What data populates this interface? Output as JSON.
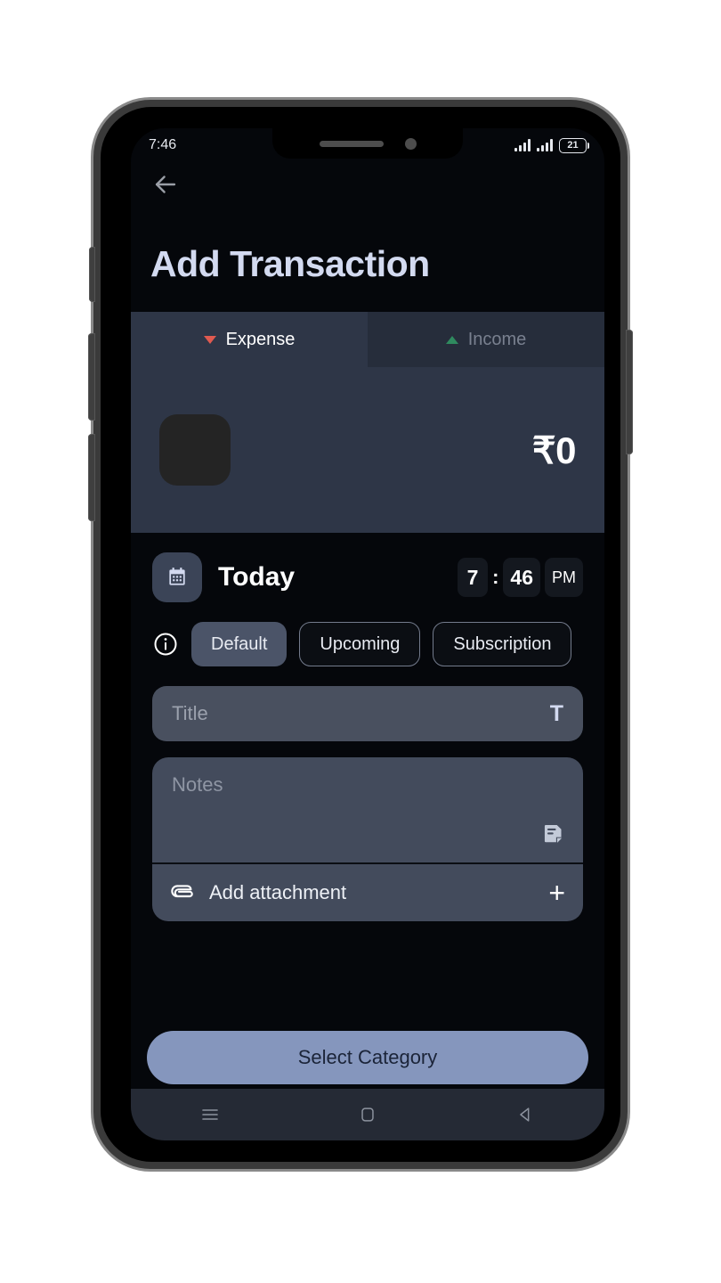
{
  "status_bar": {
    "time": "7:46",
    "battery_percent": "21",
    "signal_icon": "signal-bars-icon",
    "battery_icon": "battery-icon"
  },
  "header": {
    "back_icon": "back-arrow-icon",
    "title": "Add Transaction"
  },
  "tabs": [
    {
      "label": "Expense",
      "icon": "triangle-down-icon",
      "active": true,
      "accent": "#e05a50"
    },
    {
      "label": "Income",
      "icon": "triangle-up-icon",
      "active": false,
      "accent": "#2f8a5f"
    }
  ],
  "amount": {
    "thumbnail_name": "amount-thumbnail",
    "value": "₹0"
  },
  "date_row": {
    "calendar_icon": "calendar-icon",
    "date_label": "Today",
    "hour": "7",
    "separator": ":",
    "minute": "46",
    "meridiem": "PM"
  },
  "type_chips": {
    "info_icon": "info-icon",
    "items": [
      {
        "label": "Default",
        "selected": true
      },
      {
        "label": "Upcoming",
        "selected": false
      },
      {
        "label": "Subscription",
        "selected": false
      }
    ]
  },
  "title_field": {
    "placeholder": "Title",
    "value": "",
    "icon": "text-format-icon",
    "icon_glyph": "T"
  },
  "notes_field": {
    "placeholder": "Notes",
    "value": "",
    "icon": "note-icon"
  },
  "attachment": {
    "label": "Add attachment",
    "clip_icon": "paperclip-icon",
    "add_icon": "plus-icon",
    "add_glyph": "+"
  },
  "cta": {
    "label": "Select Category",
    "background": "#8596bd",
    "text_color": "#1b2438"
  },
  "navbar": {
    "menu_icon": "menu-icon",
    "home_icon": "home-square-icon",
    "back_icon": "back-triangle-icon"
  },
  "theme": {
    "screen_bg": "#05070b",
    "panel_bg": "#2e3647",
    "tab_active_bg": "#2e3647",
    "tab_inactive_bg": "#262d3b",
    "title_color": "#d3daf0",
    "input_bg": "#49505f"
  }
}
